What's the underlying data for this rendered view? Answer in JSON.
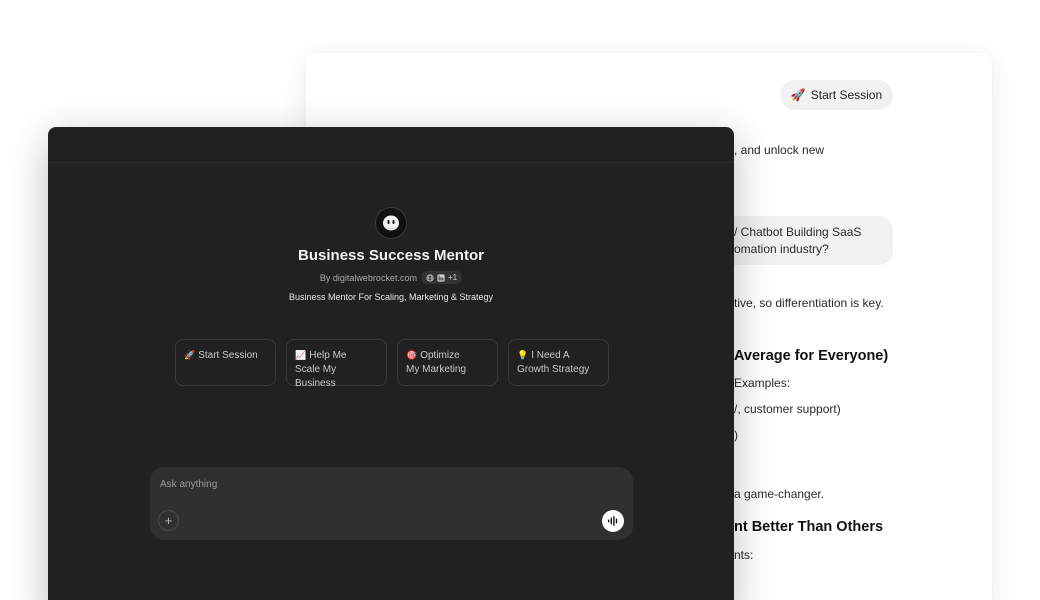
{
  "back_window": {
    "start_session_pill": {
      "emoji": "🚀",
      "label": "Start Session"
    },
    "lines": [
      {
        "text": ", and unlock new"
      },
      {
        "text": "/ Chatbot Building SaaS"
      },
      {
        "text": "omation industry?"
      },
      {
        "text": "tive, so differentiation is key."
      },
      {
        "text": "Examples:"
      },
      {
        "text": "/, customer support)"
      },
      {
        "text": ")"
      },
      {
        "text": "a game-changer."
      },
      {
        "text": "nts:"
      }
    ],
    "headings": [
      {
        "text": "Average for Everyone)"
      },
      {
        "text": "nt Better Than Others"
      }
    ]
  },
  "front_window": {
    "gpt": {
      "avatar_icon": "robot-face-icon",
      "title": "Business Success Mentor",
      "by_label": "By digitalwebrocket.com",
      "social_count": "+1",
      "description": "Business Mentor For Scaling, Marketing & Strategy"
    },
    "starters": [
      {
        "emoji": "🚀",
        "line1": "Start Session",
        "line2": ""
      },
      {
        "emoji": "📈",
        "line1": "Help Me",
        "line2": "Scale My Business"
      },
      {
        "emoji": "🎯",
        "line1": "Optimize",
        "line2": "My Marketing"
      },
      {
        "emoji": "💡",
        "line1": "I Need A",
        "line2": "Growth Strategy"
      }
    ],
    "composer": {
      "placeholder": "Ask anything",
      "value": "",
      "plus_label": "+"
    }
  }
}
